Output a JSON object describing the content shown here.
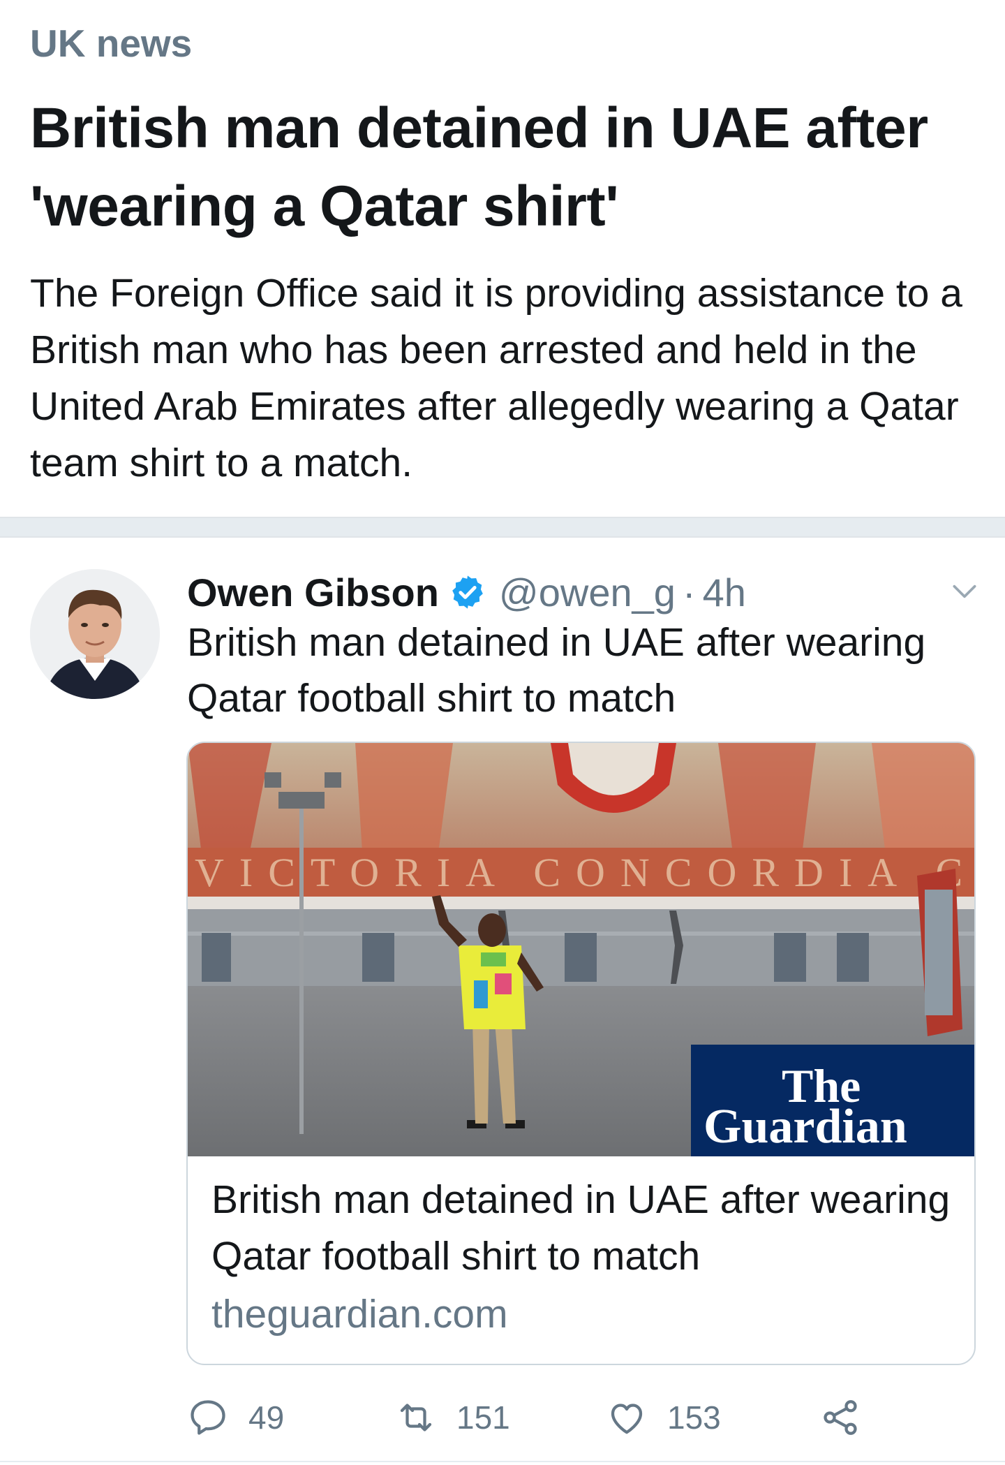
{
  "header": {
    "category": "UK news",
    "headline": "British man detained in UAE after 'wearing a Qatar shirt'",
    "summary": "The Foreign Office said it is providing assistance to a British man who has been arrested and held in the United Arab Emirates after allegedly wearing a Qatar team shirt to a match."
  },
  "tweet": {
    "author_name": "Owen Gibson",
    "handle": "@owen_g",
    "separator": "·",
    "time": "4h",
    "text": "British man detained in UAE after wearing Qatar football shirt to match",
    "card": {
      "image_banner_text": "VICTORIA CONCORDIA CRES",
      "publisher_logo_line1": "The",
      "publisher_logo_line2": "Guardian",
      "title": "British man detained in UAE after wearing Qatar football shirt to match",
      "domain": "theguardian.com"
    },
    "actions": {
      "replies": "49",
      "retweets": "151",
      "likes": "153"
    }
  },
  "colors": {
    "text_primary": "#14171a",
    "text_secondary": "#657786",
    "verified_blue": "#1da1f2",
    "divider": "#e6ecf0",
    "guardian_blue": "#052962"
  },
  "icons": {
    "verified": "verified-badge-icon",
    "caret": "chevron-down-icon",
    "reply": "reply-icon",
    "retweet": "retweet-icon",
    "like": "heart-icon",
    "share": "share-icon"
  }
}
